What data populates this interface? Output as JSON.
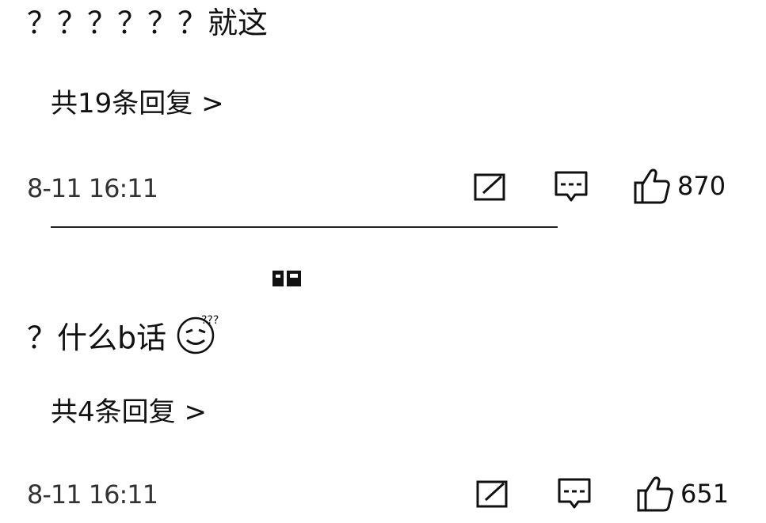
{
  "comments": [
    {
      "text": "？？？？？？就这",
      "replies_label": "共19条回复 >",
      "timestamp": "8-11 16:11",
      "likes": "870"
    },
    {
      "text": "？什么b话",
      "emoji": "sweat-confused-emoji",
      "replies_label": "共4条回复 >",
      "timestamp": "8-11 16:11",
      "likes": "651"
    }
  ],
  "icons": {
    "share": "share-icon",
    "reply": "comment-icon",
    "like": "thumbs-up-icon"
  }
}
